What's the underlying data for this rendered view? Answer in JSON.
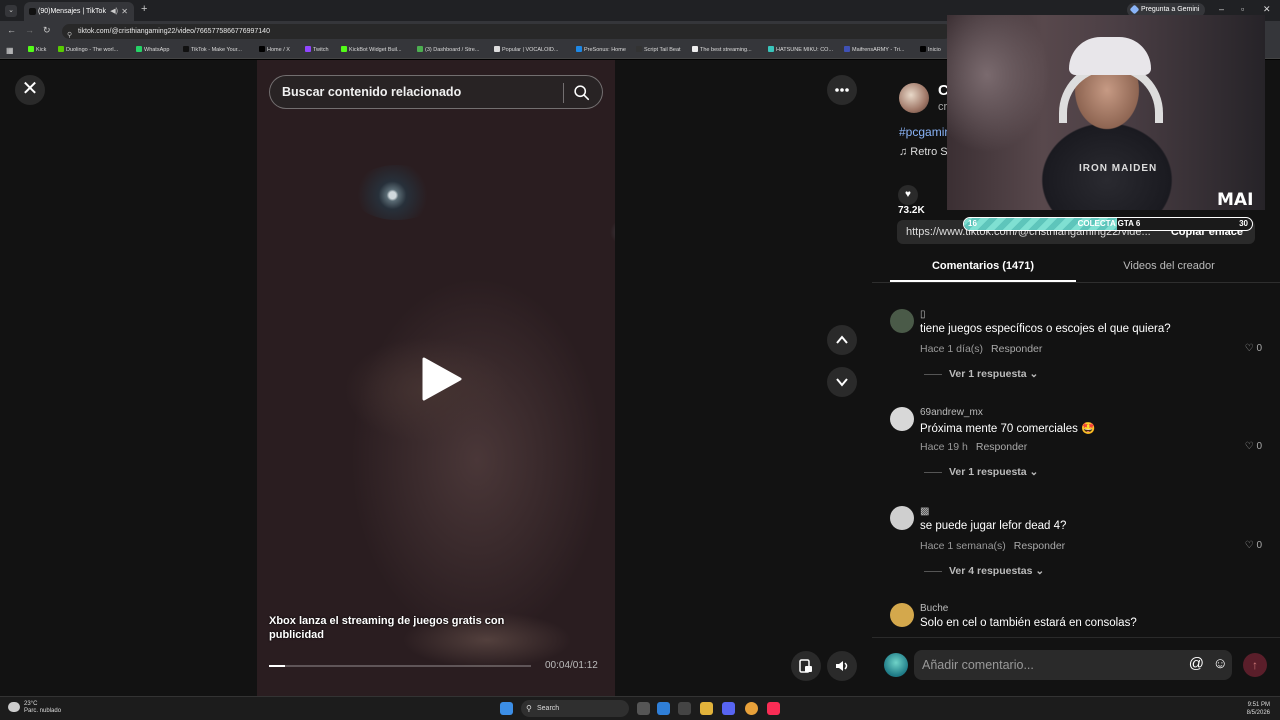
{
  "browser": {
    "tab_title": "(90)Mensajes | TikTok",
    "new_tab": "+",
    "gemini_label": "Pregunta a Gemini",
    "url": "tiktok.com/@cristhiangaming22/video/7665775866776997140",
    "window": {
      "minimize": "–",
      "maximize": "▫",
      "close": "✕"
    }
  },
  "bookmarks": [
    {
      "label": "Kick",
      "color": "#53fc18"
    },
    {
      "label": "Duolingo - The worl...",
      "color": "#58cc02"
    },
    {
      "label": "WhatsApp",
      "color": "#25d366"
    },
    {
      "label": "TikTok - Make Your...",
      "color": "#111111"
    },
    {
      "label": "Home / X",
      "color": "#000000"
    },
    {
      "label": "Twitch",
      "color": "#9146ff"
    },
    {
      "label": "KickBot Widget Buil...",
      "color": "#53fc18"
    },
    {
      "label": "(3) Dashboard / Stre...",
      "color": "#4caf50"
    },
    {
      "label": "Popular | VOCALOID...",
      "color": "#dddddd"
    },
    {
      "label": "PreSonus: Home",
      "color": "#1e88e5"
    },
    {
      "label": "Script Tail Beat",
      "color": "#333333"
    },
    {
      "label": "The best streaming...",
      "color": "#eeeeee"
    },
    {
      "label": "HATSUNE MIKU: CO...",
      "color": "#39c5bb"
    },
    {
      "label": "MaifrensARMY - Tri...",
      "color": "#3f51b5"
    },
    {
      "label": "Inicio",
      "color": "#000000"
    }
  ],
  "video": {
    "search_placeholder": "Buscar contenido relacionado",
    "caption": "Xbox lanza el streaming de juegos gratis con publicidad",
    "time": "00:04/01:12",
    "progress": 0.06
  },
  "creator": {
    "name": "C",
    "handle": "cr",
    "hashtag": "#pcgamin",
    "music": "♫  Retro S",
    "likes": "73.2K",
    "link": "https://www.tiktok.com/@cristhiangaming22/vide...",
    "copy_link": "Copiar enlace"
  },
  "tabs": {
    "comments": "Comentarios (1471)",
    "creator_videos": "Videos del creador"
  },
  "comments": [
    {
      "user": "▯",
      "text": "tiene juegos específicos o escojes el que quiera?",
      "time": "Hace 1 día(s)",
      "reply": "Responder",
      "likes": "0",
      "more": "Ver 1 respuesta",
      "avatar": "#4a5a48"
    },
    {
      "user": "69andrew_mx",
      "text": "Próxima mente 70 comerciales 🤩",
      "time": "Hace 19 h",
      "reply": "Responder",
      "likes": "0",
      "more": "Ver 1 respuesta",
      "avatar": "#d8d8d8"
    },
    {
      "user": "▩",
      "text": "se puede jugar lefor dead 4?",
      "time": "Hace 1 semana(s)",
      "reply": "Responder",
      "likes": "0",
      "more": "Ver 4 respuestas",
      "avatar": "#cfcfcf"
    },
    {
      "user": "Buche",
      "text": "Solo en cel o también estará en consolas?",
      "time": "",
      "reply": "",
      "likes": "",
      "more": "",
      "avatar": "#d4a84c"
    }
  ],
  "comment_input": {
    "placeholder": "Añadir comentario...",
    "at": "@",
    "emoji": "☺",
    "send": "↑"
  },
  "overlay": {
    "logo": "MAI",
    "shirt_text": "IRON MAIDEN",
    "goal_left": "16",
    "goal_label": "COLECTA GTA 6",
    "goal_right": "30",
    "goal_progress": 0.53
  },
  "taskbar": {
    "temp": "23°C",
    "weather": "Parc. nublado",
    "search": "Search",
    "time": "9:51 PM",
    "date": "8/5/2026"
  }
}
